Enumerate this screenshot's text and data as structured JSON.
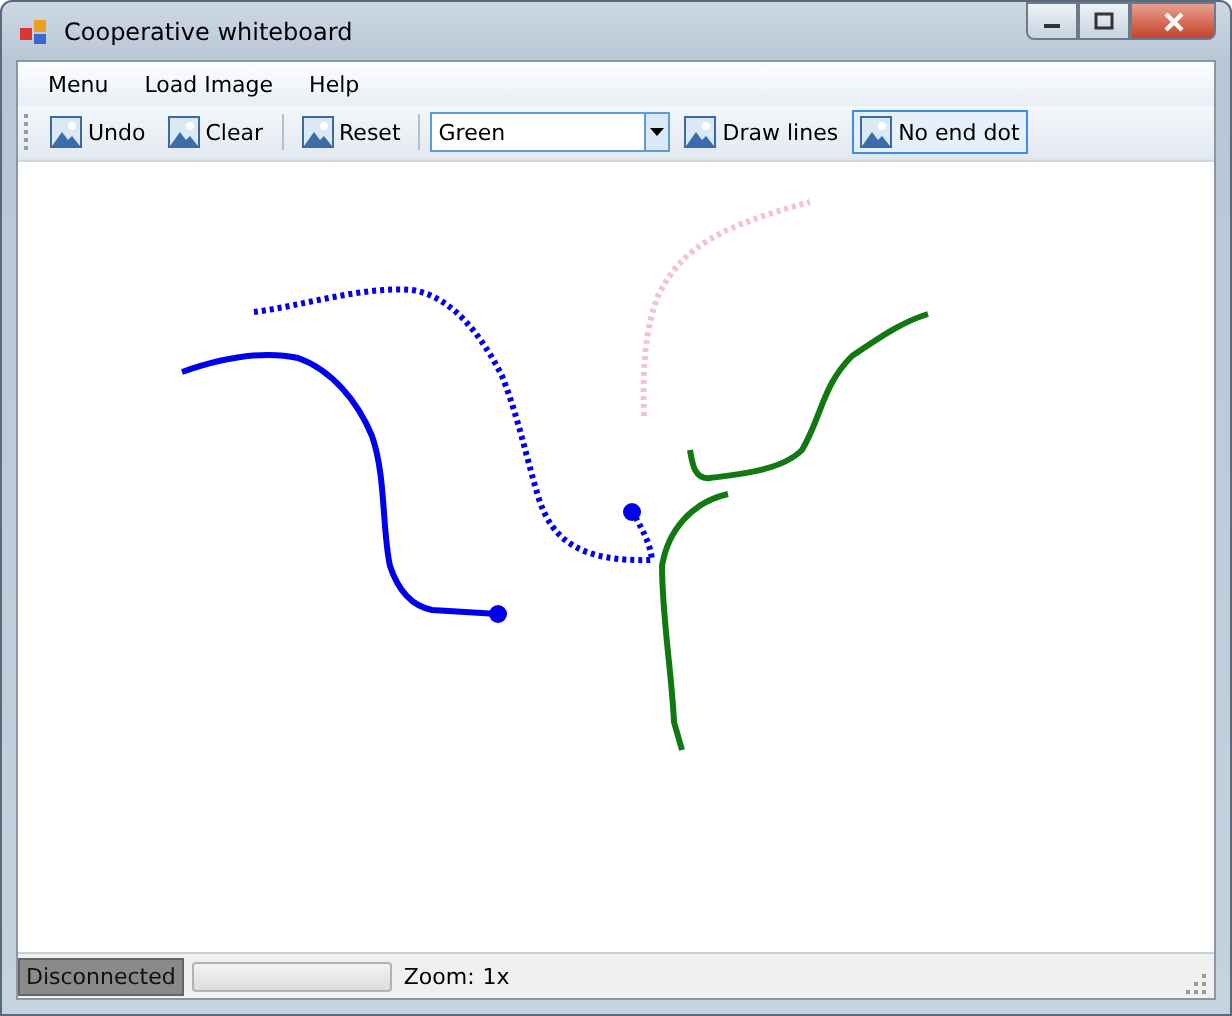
{
  "window": {
    "title": "Cooperative whiteboard"
  },
  "menu": [
    "Menu",
    "Load Image",
    "Help"
  ],
  "toolbar": [
    {
      "kind": "button",
      "label": "Undo",
      "checked": false
    },
    {
      "kind": "button",
      "label": "Clear",
      "checked": false
    },
    {
      "kind": "separator"
    },
    {
      "kind": "button",
      "label": "Reset",
      "checked": false
    },
    {
      "kind": "separator"
    },
    {
      "kind": "combo",
      "value": "Green"
    },
    {
      "kind": "button",
      "label": "Draw lines",
      "checked": false
    },
    {
      "kind": "button",
      "label": "No end dot",
      "checked": true
    }
  ],
  "status_bar": {
    "connection": "Disconnected",
    "progress": {
      "level": 0
    },
    "zoom_label": "Zoom:",
    "zoom_value": "1x"
  }
}
